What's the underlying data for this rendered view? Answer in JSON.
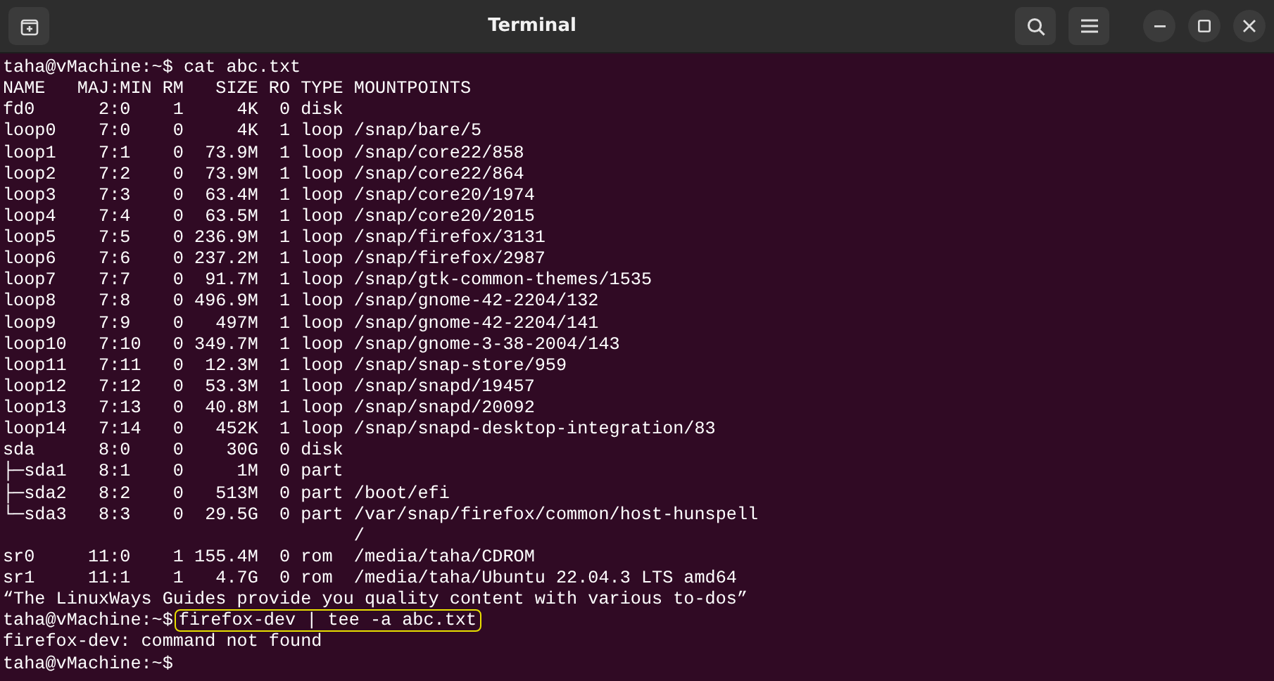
{
  "window": {
    "title": "Terminal"
  },
  "terminal": {
    "lines": [
      {
        "kind": "prompt",
        "prompt": "taha@vMachine:~$",
        "command": "cat abc.txt"
      },
      {
        "kind": "output",
        "text": "NAME   MAJ:MIN RM   SIZE RO TYPE MOUNTPOINTS"
      },
      {
        "kind": "output",
        "text": "fd0      2:0    1     4K  0 disk"
      },
      {
        "kind": "output",
        "text": "loop0    7:0    0     4K  1 loop /snap/bare/5"
      },
      {
        "kind": "output",
        "text": "loop1    7:1    0  73.9M  1 loop /snap/core22/858"
      },
      {
        "kind": "output",
        "text": "loop2    7:2    0  73.9M  1 loop /snap/core22/864"
      },
      {
        "kind": "output",
        "text": "loop3    7:3    0  63.4M  1 loop /snap/core20/1974"
      },
      {
        "kind": "output",
        "text": "loop4    7:4    0  63.5M  1 loop /snap/core20/2015"
      },
      {
        "kind": "output",
        "text": "loop5    7:5    0 236.9M  1 loop /snap/firefox/3131"
      },
      {
        "kind": "output",
        "text": "loop6    7:6    0 237.2M  1 loop /snap/firefox/2987"
      },
      {
        "kind": "output",
        "text": "loop7    7:7    0  91.7M  1 loop /snap/gtk-common-themes/1535"
      },
      {
        "kind": "output",
        "text": "loop8    7:8    0 496.9M  1 loop /snap/gnome-42-2204/132"
      },
      {
        "kind": "output",
        "text": "loop9    7:9    0   497M  1 loop /snap/gnome-42-2204/141"
      },
      {
        "kind": "output",
        "text": "loop10   7:10   0 349.7M  1 loop /snap/gnome-3-38-2004/143"
      },
      {
        "kind": "output",
        "text": "loop11   7:11   0  12.3M  1 loop /snap/snap-store/959"
      },
      {
        "kind": "output",
        "text": "loop12   7:12   0  53.3M  1 loop /snap/snapd/19457"
      },
      {
        "kind": "output",
        "text": "loop13   7:13   0  40.8M  1 loop /snap/snapd/20092"
      },
      {
        "kind": "output",
        "text": "loop14   7:14   0   452K  1 loop /snap/snapd-desktop-integration/83"
      },
      {
        "kind": "output",
        "text": "sda      8:0    0    30G  0 disk"
      },
      {
        "kind": "output",
        "text": "├─sda1   8:1    0     1M  0 part"
      },
      {
        "kind": "output",
        "text": "├─sda2   8:2    0   513M  0 part /boot/efi"
      },
      {
        "kind": "output",
        "text": "└─sda3   8:3    0  29.5G  0 part /var/snap/firefox/common/host-hunspell"
      },
      {
        "kind": "output",
        "text": "                                 /"
      },
      {
        "kind": "output",
        "text": "sr0     11:0    1 155.4M  0 rom  /media/taha/CDROM"
      },
      {
        "kind": "output",
        "text": "sr1     11:1    1   4.7G  0 rom  /media/taha/Ubuntu 22.04.3 LTS amd64"
      },
      {
        "kind": "output",
        "text": "“The LinuxWays Guides provide you quality content with various to-dos”"
      },
      {
        "kind": "prompt",
        "prompt": "taha@vMachine:~$",
        "command": "firefox-dev | tee -a abc.txt",
        "highlighted": true
      },
      {
        "kind": "output",
        "text": "firefox-dev: command not found"
      },
      {
        "kind": "prompt",
        "prompt": "taha@vMachine:~$"
      }
    ]
  }
}
